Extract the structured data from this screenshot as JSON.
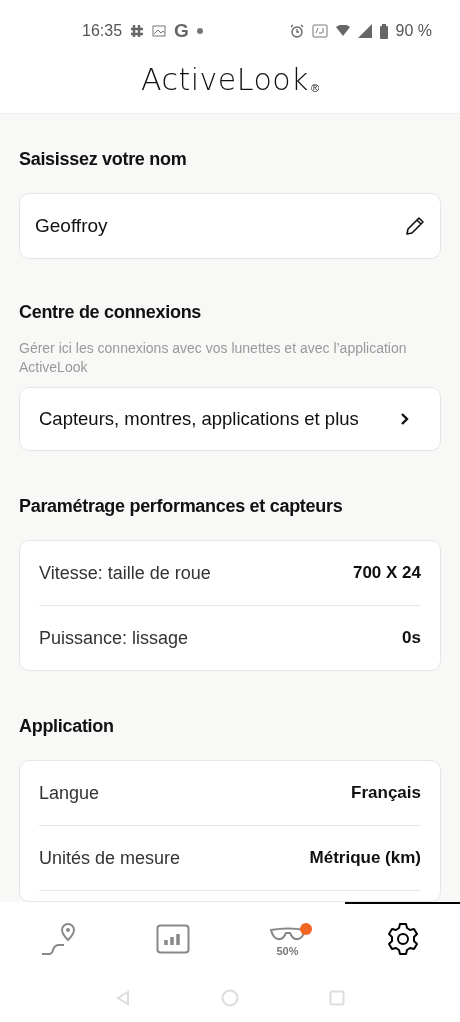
{
  "status_bar": {
    "time": "16:35",
    "app_letter": "G",
    "battery": "90 %"
  },
  "header": {
    "logo": "ActiveLook",
    "logo_mark": "®"
  },
  "name_section": {
    "title": "Saisissez votre nom",
    "value": "Geoffroy"
  },
  "connections": {
    "title": "Centre de connexions",
    "description": "Gérer ici les connexions avec vos lunettes et avec l’application ActiveLook",
    "link": "Capteurs, montres, applications et plus"
  },
  "performance": {
    "title": "Paramétrage performances et capteurs",
    "rows": [
      {
        "label": "Vitesse: taille de roue",
        "value": "700 X 24"
      },
      {
        "label": "Puissance: lissage",
        "value": "0s"
      }
    ]
  },
  "application": {
    "title": "Application",
    "rows": [
      {
        "label": "Langue",
        "value": "Français"
      },
      {
        "label": "Unités de mesure",
        "value": "Métrique (km)"
      }
    ]
  },
  "bottom_nav": [
    {
      "kind": "route",
      "selected": false
    },
    {
      "kind": "stats",
      "selected": false
    },
    {
      "kind": "glasses",
      "selected": false,
      "badge": "50%",
      "color": "#f26522"
    },
    {
      "kind": "settings",
      "selected": true
    }
  ]
}
